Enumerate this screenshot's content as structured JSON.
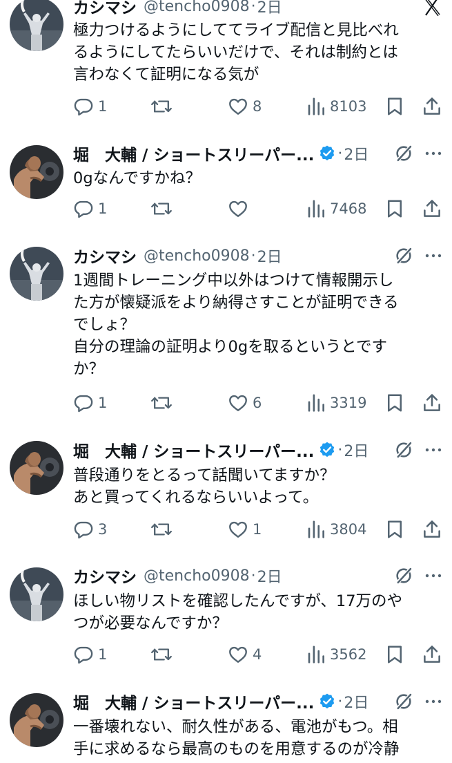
{
  "close_icon": "x-logo",
  "tweets": [
    {
      "name": "カシマシ",
      "handle": "@tencho0908",
      "dot": "·",
      "time": "2日",
      "verified": false,
      "avatar": "silhouette",
      "lines": [
        "極力つけるようにしててライブ配信と見比べれ",
        "るようにしてたらいいだけで、それは制約とは",
        "言わなくて証明になる気が"
      ],
      "replies": "1",
      "reposts": "",
      "likes": "8",
      "views": "8103"
    },
    {
      "name": "堀　大輔 / ショートスリーパー...",
      "handle": "",
      "dot": "·",
      "time": "2日",
      "verified": true,
      "avatar": "muscle",
      "lines": [
        "0gなんですかね？"
      ],
      "replies": "1",
      "reposts": "",
      "likes": "",
      "views": "7468"
    },
    {
      "name": "カシマシ",
      "handle": "@tencho0908",
      "dot": "·",
      "time": "2日",
      "verified": false,
      "avatar": "silhouette",
      "lines": [
        "1週間トレーニング中以外はつけて情報開示し",
        "た方が懐疑派をより納得さすことが証明できる",
        "でしょ？",
        "自分の理論の証明より0gを取るというとです",
        "か？"
      ],
      "replies": "1",
      "reposts": "",
      "likes": "6",
      "views": "3319"
    },
    {
      "name": "堀　大輔 / ショートスリーパー...",
      "handle": "",
      "dot": "·",
      "time": "2日",
      "verified": true,
      "avatar": "muscle",
      "lines": [
        "普段通りをとるって話聞いてますか？",
        "あと買ってくれるならいいよって。"
      ],
      "replies": "3",
      "reposts": "",
      "likes": "1",
      "views": "3804"
    },
    {
      "name": "カシマシ",
      "handle": "@tencho0908",
      "dot": "·",
      "time": "2日",
      "verified": false,
      "avatar": "silhouette",
      "lines": [
        "ほしい物リストを確認したんですが、17万のや",
        "つが必要なんですか？"
      ],
      "replies": "1",
      "reposts": "",
      "likes": "4",
      "views": "3562"
    },
    {
      "name": "堀　大輔 / ショートスリーパー...",
      "handle": "",
      "dot": "·",
      "time": "2日",
      "verified": true,
      "avatar": "muscle",
      "lines": [
        "一番壊れない、耐久性がある、電池がもつ。相",
        "手に求めるなら最高のものを用意するのが冷静"
      ],
      "replies": "",
      "reposts": "",
      "likes": "",
      "views": ""
    }
  ],
  "colors": {
    "text": "#0f1419",
    "secondary": "#536471",
    "verified": "#1d9bf0"
  }
}
